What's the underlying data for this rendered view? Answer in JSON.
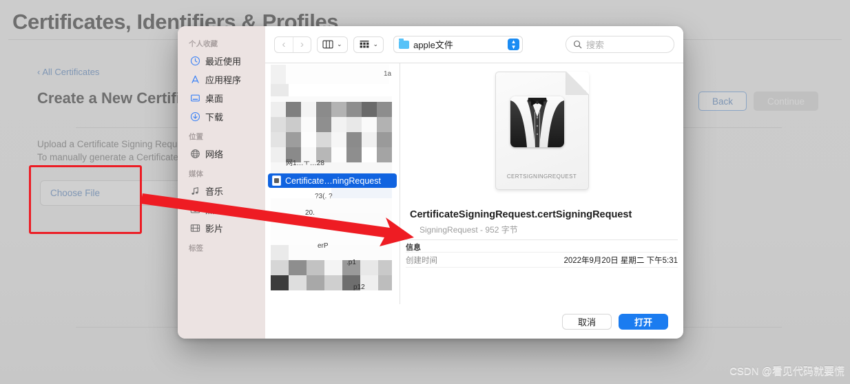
{
  "page": {
    "title": "Certificates, Identifiers & Profiles",
    "breadcrumb_chevron": "‹",
    "breadcrumb": "All Certificates",
    "section_title": "Create a New Certificate",
    "description_line1": "Upload a Certificate Signing Request",
    "description_line2": "To manually generate a Certificate",
    "choose_file_label": "Choose File",
    "back_label": "Back",
    "continue_label": "Continue"
  },
  "finder": {
    "sidebar": {
      "groups": [
        {
          "header": "个人收藏",
          "items": [
            {
              "label": "最近使用",
              "icon": "clock-icon"
            },
            {
              "label": "应用程序",
              "icon": "applications-icon"
            },
            {
              "label": "桌面",
              "icon": "desktop-icon"
            },
            {
              "label": "下载",
              "icon": "downloads-icon"
            }
          ]
        },
        {
          "header": "位置",
          "items": [
            {
              "label": "网络",
              "icon": "globe-icon"
            }
          ]
        },
        {
          "header": "媒体",
          "items": [
            {
              "label": "音乐",
              "icon": "music-note-icon"
            },
            {
              "label": "照片",
              "icon": "camera-icon"
            },
            {
              "label": "影片",
              "icon": "film-icon"
            }
          ]
        },
        {
          "header": "标签",
          "items": []
        }
      ]
    },
    "toolbar": {
      "back_glyph": "‹",
      "forward_glyph": "›",
      "view_chevron": "⌄",
      "group_chevron": "⌄",
      "path_label": "apple文件",
      "search_placeholder": "搜索",
      "search_value": ""
    },
    "file_list": {
      "rows": [
        {
          "label": "",
          "selected": false,
          "redacted": true
        },
        {
          "label": "",
          "selected": false,
          "redacted": true
        },
        {
          "label": "Certificate…ningRequest",
          "selected": true,
          "redacted": false
        },
        {
          "label": "",
          "selected": false,
          "redacted": true
        },
        {
          "label": "",
          "selected": false,
          "redacted": true
        }
      ]
    },
    "preview": {
      "doc_icon_label": "CERTSIGNINGREQUEST",
      "file_name": "CertificateSigningRequest.certSigningRequest",
      "file_subtitle": "SigningRequest - 952 字节",
      "info_header": "信息",
      "created_label": "创建时间",
      "created_value": "2022年9月20日 星期二 下午5:31"
    },
    "footer": {
      "cancel_label": "取消",
      "open_label": "打开"
    }
  },
  "annotations": {
    "highlight_color": "#ec1c24",
    "arrow_color": "#ee1c23"
  },
  "watermark": "CSDN @看见代码就要慌"
}
